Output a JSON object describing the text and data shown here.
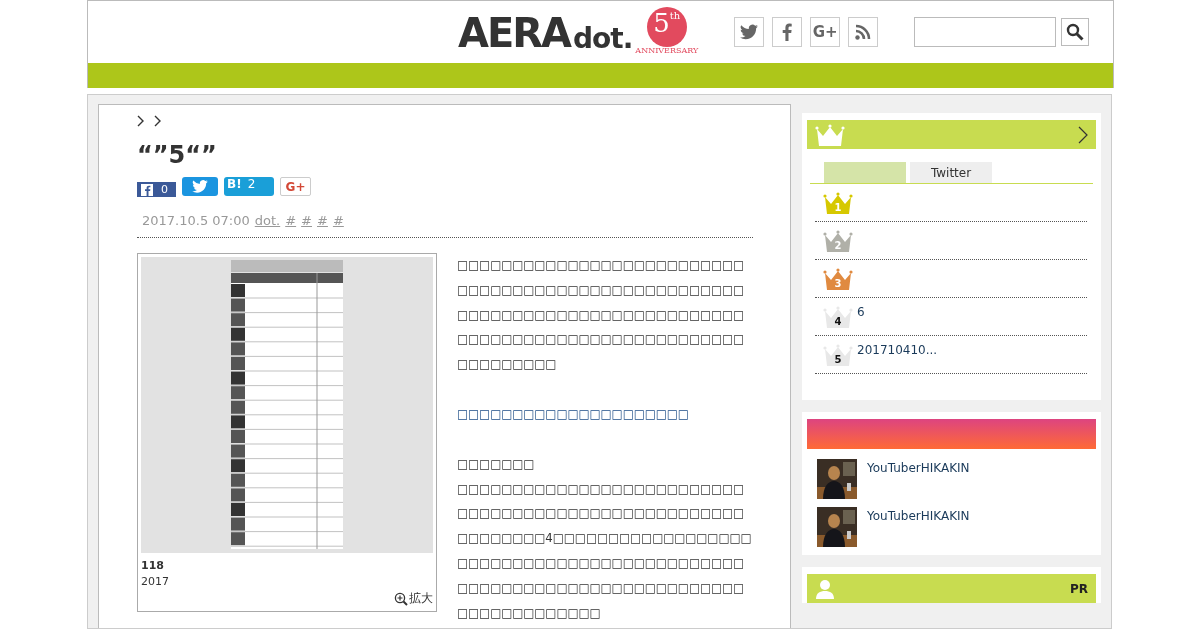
{
  "header": {
    "logo": {
      "word": "AERA",
      "suffix": "dot.",
      "anniversary_number": "5",
      "anniversary_suffix": "th",
      "anniversary_text": "ANNIVERSARY"
    },
    "social_icons": [
      {
        "kind": "twitter"
      },
      {
        "kind": "facebook"
      },
      {
        "kind": "googleplus",
        "label": "G+"
      },
      {
        "kind": "rss"
      }
    ]
  },
  "article": {
    "title": "“”5“”",
    "share": [
      {
        "kind": "facebook",
        "count": "0"
      },
      {
        "kind": "twitter"
      },
      {
        "kind": "hatena",
        "label": "B!",
        "count": "2"
      },
      {
        "kind": "googleplus",
        "label": "G+"
      }
    ],
    "date": "2017.10.5 07:00",
    "source": "dot.",
    "tags": [
      "#",
      "#",
      "#",
      "#"
    ],
    "figure": {
      "kind": "picture",
      "caption_title": "118",
      "caption_text": "2017",
      "zoom_label": "拡大"
    },
    "body": [
      {
        "kind": "paragraph",
        "text": "□□□□□□□□□□□□□□□□□□□□□□□□□□□□□□□□□□□□□□□□□□□□□□□□□□□□□□□□□□□□□□□□□□□□□□□□□□□□□□□□□□□□□□□□□□□□□□□□□□□□□□□□□□□□□□□□□"
      },
      {
        "kind": "link",
        "text": "□□□□□□□□□□□□□□□□□□□□□"
      },
      {
        "kind": "heading",
        "text": "□□□□□□□"
      },
      {
        "kind": "paragraph",
        "text": "□□□□□□□□□□□□□□□□□□□□□□□□□□□□□□□□□□□□□□□□□□□□□□□□□□□□□□□□□□□□4□□□□□□□□□□□□□□□□□□□□□□□□□□□□□□□□□□□□□□□□□□□□□□□□□□□□□□□□□□□□□□□□□□□□□□□□□□□□□□□□□□□"
      }
    ]
  },
  "sidebar": {
    "ranking": {
      "tabs": [
        {
          "selected": true
        },
        {
          "label": "Twitter",
          "selected": false
        }
      ],
      "items": [
        {
          "rank": "1",
          "color": "#d6c800"
        },
        {
          "rank": "2",
          "color": "#b0b0a8"
        },
        {
          "rank": "3",
          "color": "#e08a40"
        },
        {
          "rank": "4",
          "color": "#e8e8e8",
          "title": "6"
        },
        {
          "rank": "5",
          "color": "#e8e8e8",
          "title": "201710410..."
        }
      ]
    },
    "videos": {
      "items": [
        {
          "kind": "picture",
          "title": "YouTuberHIKAKIN"
        },
        {
          "kind": "picture",
          "title": "YouTuberHIKAKIN"
        }
      ]
    },
    "pr": {
      "label": "PR"
    }
  }
}
